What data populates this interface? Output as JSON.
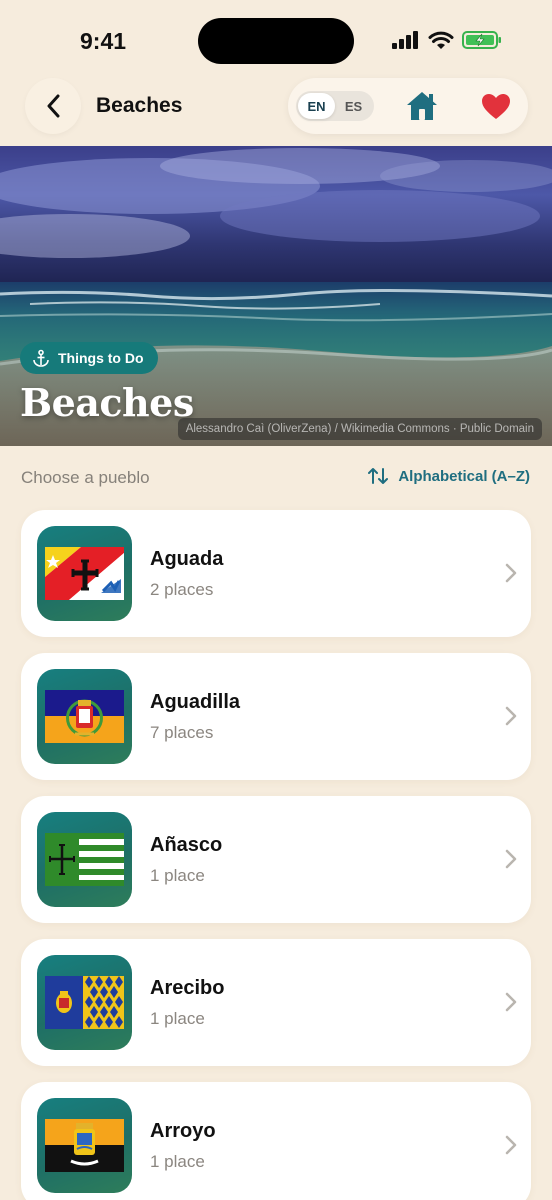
{
  "status_bar": {
    "time": "9:41"
  },
  "header": {
    "title": "Beaches",
    "language": {
      "options": [
        "EN",
        "ES"
      ],
      "selected": "EN"
    },
    "accent_color": "#1f6e80",
    "favorite_color": "#e2323c"
  },
  "hero": {
    "category": "Things to Do",
    "title": "Beaches",
    "credit": "Alessandro Caì (OliverZena) / Wikimedia Commons · Public Domain"
  },
  "list": {
    "label": "Choose a pueblo",
    "sort_label": "Alphabetical (A–Z)",
    "items": [
      {
        "name": "Aguada",
        "count": "2 places",
        "flag": "aguada-flag"
      },
      {
        "name": "Aguadilla",
        "count": "7 places",
        "flag": "aguadilla-flag"
      },
      {
        "name": "Añasco",
        "count": "1 place",
        "flag": "anasco-flag"
      },
      {
        "name": "Arecibo",
        "count": "1 place",
        "flag": "arecibo-flag"
      },
      {
        "name": "Arroyo",
        "count": "1 place",
        "flag": "arroyo-flag"
      }
    ]
  }
}
